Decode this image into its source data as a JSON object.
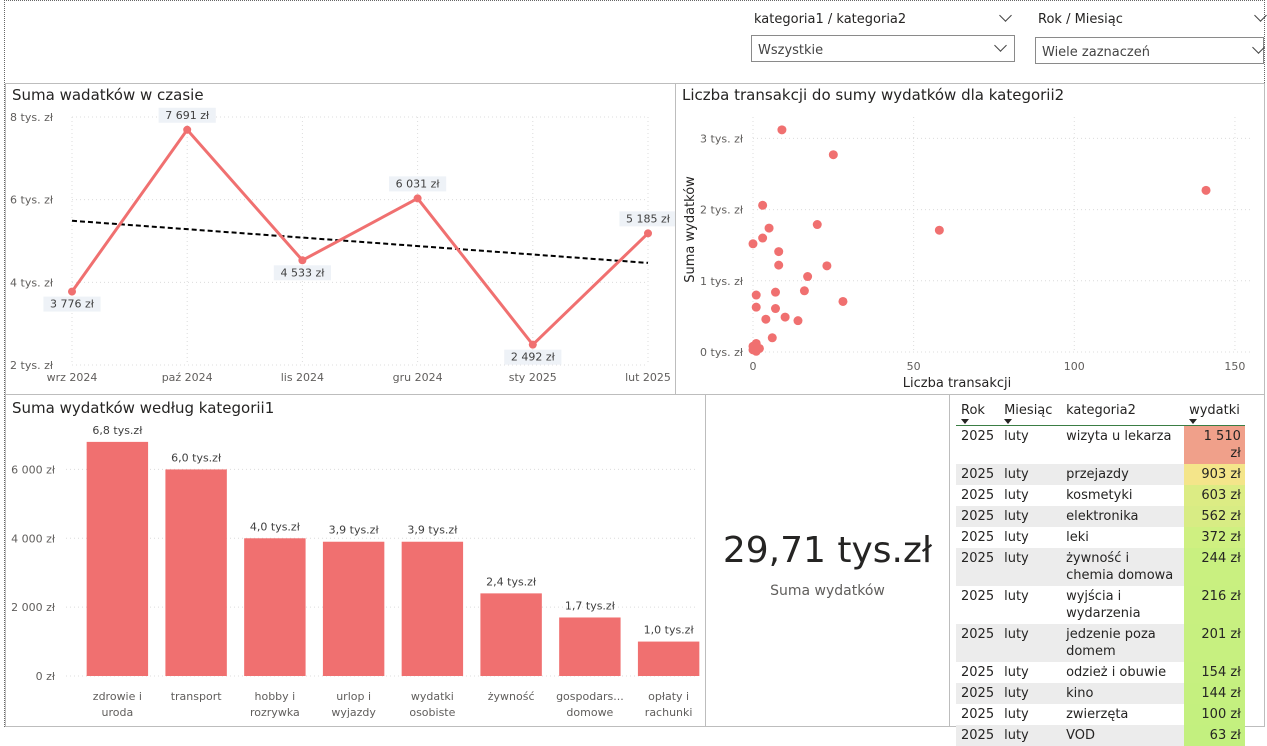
{
  "slicers": [
    {
      "label": "kategoria1 / kategoria2",
      "value": "Wszystkie"
    },
    {
      "label": "Rok / Miesiąc",
      "value": "Wiele zaznaczeń"
    }
  ],
  "line_panel": {
    "title": "Suma wadatków w czasie"
  },
  "scatter_panel": {
    "title": "Liczba transakcji do sumy wydatków dla kategorii2"
  },
  "bar_panel": {
    "title": "Suma wydatków według kategorii1"
  },
  "kpi": {
    "value": "29,71 tys.zł",
    "caption": "Suma wydatków"
  },
  "matrix": {
    "headers": [
      "Rok",
      "Miesiąc",
      "kategoria2",
      "wydatki"
    ],
    "rows": [
      {
        "rok": "2025",
        "miesiac": "luty",
        "kategoria": "wizyta u lekarza",
        "wydatki": "1 510 zł",
        "color": "#f0a08a"
      },
      {
        "rok": "2025",
        "miesiac": "luty",
        "kategoria": "przejazdy",
        "wydatki": "903 zł",
        "color": "#f4e58a"
      },
      {
        "rok": "2025",
        "miesiac": "luty",
        "kategoria": "kosmetyki",
        "wydatki": "603 zł",
        "color": "#dcec84"
      },
      {
        "rok": "2025",
        "miesiac": "luty",
        "kategoria": "elektronika",
        "wydatki": "562 zł",
        "color": "#d8ec84"
      },
      {
        "rok": "2025",
        "miesiac": "luty",
        "kategoria": "leki",
        "wydatki": "372 zł",
        "color": "#cff081"
      },
      {
        "rok": "2025",
        "miesiac": "luty",
        "kategoria": "żywność i chemia domowa",
        "wydatki": "244 zł",
        "color": "#c9f080"
      },
      {
        "rok": "2025",
        "miesiac": "luty",
        "kategoria": "wyjścia i wydarzenia",
        "wydatki": "216 zł",
        "color": "#c8f080"
      },
      {
        "rok": "2025",
        "miesiac": "luty",
        "kategoria": "jedzenie poza domem",
        "wydatki": "201 zł",
        "color": "#c7f080"
      },
      {
        "rok": "2025",
        "miesiac": "luty",
        "kategoria": "odzież i obuwie",
        "wydatki": "154 zł",
        "color": "#c6f080"
      },
      {
        "rok": "2025",
        "miesiac": "luty",
        "kategoria": "kino",
        "wydatki": "144 zł",
        "color": "#c5f07f"
      },
      {
        "rok": "2025",
        "miesiac": "luty",
        "kategoria": "zwierzęta",
        "wydatki": "100 zł",
        "color": "#c4f07f"
      },
      {
        "rok": "2025",
        "miesiac": "luty",
        "kategoria": "VOD",
        "wydatki": "63 zł",
        "color": "#c3f07f"
      }
    ]
  },
  "chart_data": [
    {
      "type": "line",
      "title": "Suma wadatków w czasie",
      "categories": [
        "wrz 2024",
        "paź 2024",
        "lis 2024",
        "gru 2024",
        "sty 2025",
        "lut 2025"
      ],
      "values": [
        3776,
        7691,
        4533,
        6031,
        2492,
        5185
      ],
      "data_labels": [
        "3 776 zł",
        "7 691 zł",
        "4 533 zł",
        "6 031 zł",
        "2 492 zł",
        "5 185 zł"
      ],
      "ylim": [
        2000,
        8000
      ],
      "yticks": [
        2000,
        4000,
        6000,
        8000
      ],
      "ytick_labels": [
        "2 tys. zł",
        "4 tys. zł",
        "6 tys. zł",
        "8 tys. zł"
      ],
      "trend_line": [
        5490,
        4470
      ],
      "series_color": "#f07070",
      "trend_color": "#000000",
      "grid": true
    },
    {
      "type": "scatter",
      "title": "Liczba transakcji do sumy wydatków dla kategorii2",
      "xlabel": "Liczba transakcji",
      "ylabel": "Suma wydatków",
      "xlim": [
        0,
        155
      ],
      "ylim": [
        0,
        3300
      ],
      "xticks": [
        0,
        50,
        100,
        150
      ],
      "xtick_labels": [
        "0",
        "50",
        "100",
        "150"
      ],
      "yticks": [
        0,
        1000,
        2000,
        3000
      ],
      "ytick_labels": [
        "0 tys. zł",
        "1 tys. zł",
        "2 tys. zł",
        "3 tys. zł"
      ],
      "point_color": "#f07070",
      "grid": true,
      "points": [
        [
          9,
          3120
        ],
        [
          25,
          2770
        ],
        [
          141,
          2270
        ],
        [
          3,
          2060
        ],
        [
          20,
          1790
        ],
        [
          58,
          1710
        ],
        [
          5,
          1740
        ],
        [
          3,
          1600
        ],
        [
          0,
          1520
        ],
        [
          8,
          1410
        ],
        [
          8,
          1220
        ],
        [
          23,
          1210
        ],
        [
          17,
          1060
        ],
        [
          1,
          800
        ],
        [
          7,
          840
        ],
        [
          16,
          860
        ],
        [
          28,
          710
        ],
        [
          1,
          630
        ],
        [
          7,
          610
        ],
        [
          10,
          490
        ],
        [
          4,
          460
        ],
        [
          14,
          440
        ],
        [
          6,
          200
        ],
        [
          1,
          120
        ],
        [
          0,
          80
        ],
        [
          2,
          50
        ],
        [
          0,
          30
        ],
        [
          1,
          10
        ]
      ]
    },
    {
      "type": "bar",
      "title": "Suma wydatków według kategorii1",
      "categories": [
        "zdrowie i uroda",
        "transport",
        "hobby i rozrywka",
        "urlop i wyjazdy",
        "wydatki osobiste",
        "żywność",
        "gospodars... domowe",
        "opłaty i rachunki"
      ],
      "values": [
        6800,
        6000,
        4000,
        3900,
        3900,
        2400,
        1700,
        1000
      ],
      "data_labels": [
        "6,8 tys.zł",
        "6,0 tys.zł",
        "4,0 tys.zł",
        "3,9 tys.zł",
        "3,9 tys.zł",
        "2,4 tys.zł",
        "1,7 tys.zł",
        "1,0 tys.zł"
      ],
      "ylim": [
        0,
        7000
      ],
      "yticks": [
        0,
        2000,
        4000,
        6000
      ],
      "ytick_labels": [
        "0 zł",
        "2 000 zł",
        "4 000 zł",
        "6 000 zł"
      ],
      "bar_color": "#f07070",
      "grid": true
    }
  ]
}
